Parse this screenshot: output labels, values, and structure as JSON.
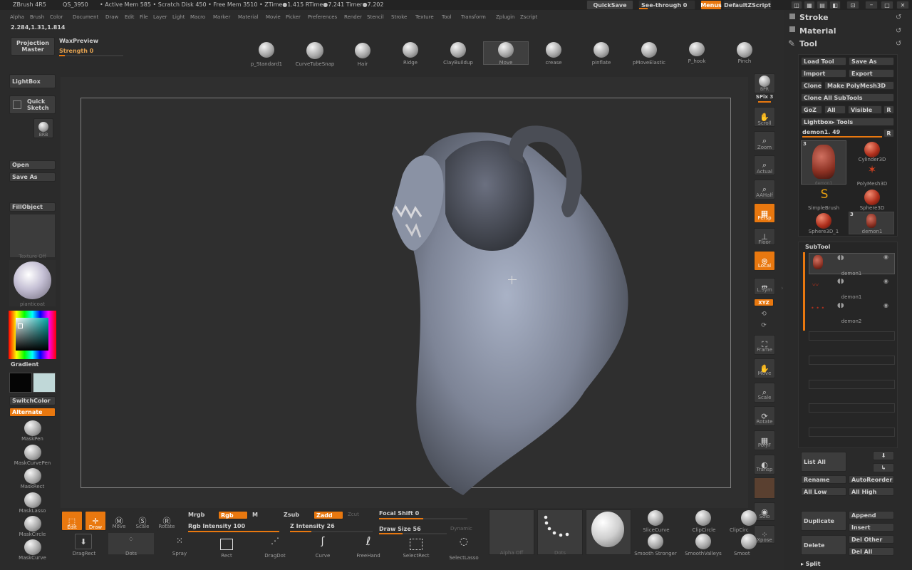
{
  "title_bar": {
    "app": "ZBrush 4R5",
    "qs": "QS_3950",
    "stats": "• Active Mem 585 • Scratch Disk 450 • Free Mem 3510 • ZTime●1.415 RTime●7.241 Timer●7.202",
    "quicksave": "QuickSave",
    "see_through": "See-through  0",
    "menus": "Menus",
    "default_zscript": "DefaultZScript"
  },
  "menu_bar": [
    "Alpha",
    "Brush",
    "Color",
    "Document",
    "Draw",
    "Edit",
    "File",
    "Layer",
    "Light",
    "Macro",
    "Marker",
    "Material",
    "Movie",
    "Picker",
    "Preferences",
    "Render",
    "Stencil",
    "Stroke",
    "Texture",
    "Tool",
    "Transform",
    "Zplugin",
    "Zscript"
  ],
  "coords": "2.284,1.31,1.814",
  "projection_master": [
    "Projection",
    "Master"
  ],
  "wax_preview": "WaxPreview",
  "strength": "Strength 0",
  "brushes": [
    "p_Standard1",
    "CurveTubeSnap",
    "Hair",
    "Ridge",
    "ClayBuildup",
    "Move",
    "crease",
    "pinflate",
    "pMoveElastic",
    "P_hook",
    "Pinch"
  ],
  "left_shelf": {
    "lightbox": "LightBox",
    "quick_sketch": [
      "Quick",
      "Sketch"
    ],
    "brush_thumb": "BRB",
    "open": "Open",
    "save_as": "Save As",
    "fill_object": "FillObject",
    "texture_off": "Texture Off",
    "material": "pianticoat",
    "gradient": "Gradient",
    "switch_color": "SwitchColor",
    "alternate": "Alternate",
    "masks": [
      "MaskPen",
      "MaskCurvePen",
      "MaskRect",
      "MaskLasso",
      "MaskCircle",
      "MaskCurve"
    ]
  },
  "right_shelf": {
    "bpr": "BPR",
    "spix": "SPix 3",
    "items": [
      "Scroll",
      "Zoom",
      "Actual",
      "AAHalf",
      "Persp",
      "Floor",
      "Local",
      "L.Sym",
      "Frame",
      "Move",
      "Scale",
      "Rotate",
      "PolyF",
      "Transp",
      "Solo",
      "Xpose"
    ],
    "xyz": "XYZ"
  },
  "bottom_bar": {
    "edit": "Edit",
    "draw": "Draw",
    "move": "Move",
    "scale": "Scale",
    "rotate": "Rotate",
    "mrgb": "Mrgb",
    "rgb": "Rgb",
    "m": "M",
    "zsub": "Zsub",
    "zadd": "Zadd",
    "zcut": "Zcut",
    "rgb_intensity": "Rgb Intensity 100",
    "z_intensity": "Z Intensity 26",
    "focal_shift": "Focal Shift 0",
    "draw_size": "Draw Size 56",
    "dynamic": "Dynamic",
    "alpha_off": "Alpha Off",
    "dots": "Dots",
    "stroke_types": [
      "DragRect",
      "Dots",
      "Spray",
      "Rect",
      "DragDot",
      "Curve",
      "FreeHand",
      "SelectRect",
      "SelectLasso"
    ],
    "brush_previews": [
      "SliceCurve",
      "ClipCircle",
      "ClipCirc",
      "Smooth Stronger",
      "SmoothValleys",
      "Smoot"
    ]
  },
  "tool_panel": {
    "stroke": "Stroke",
    "material": "Material",
    "tool": "Tool",
    "load_tool": "Load Tool",
    "save_as": "Save As",
    "import": "Import",
    "export": "Export",
    "clone": "Clone",
    "make_polymesh": "Make PolyMesh3D",
    "clone_all": "Clone  All SubTools",
    "goz": "GoZ",
    "all": "All",
    "visible": "Visible",
    "r": "R",
    "lightbox_tools": "Lightbox▸ Tools",
    "demon_slider": "demon1. 49",
    "thumb_count": "3",
    "tools": [
      "demon1",
      "Cylinder3D",
      "PolyMesh3D",
      "SimpleBrush",
      "Sphere3D",
      "Sphere3D_1",
      "demon1"
    ],
    "subtool_title": "SubTool",
    "subtools": [
      "demon1",
      "demon1",
      "demon2"
    ],
    "list_all": "List All",
    "rename": "Rename",
    "auto_reorder": "AutoReorder",
    "all_low": "All Low",
    "all_high": "All High",
    "duplicate": "Duplicate",
    "append": "Append",
    "insert": "Insert",
    "delete": "Delete",
    "del_other": "Del Other",
    "del_all": "Del All",
    "split": "▸ Split"
  }
}
